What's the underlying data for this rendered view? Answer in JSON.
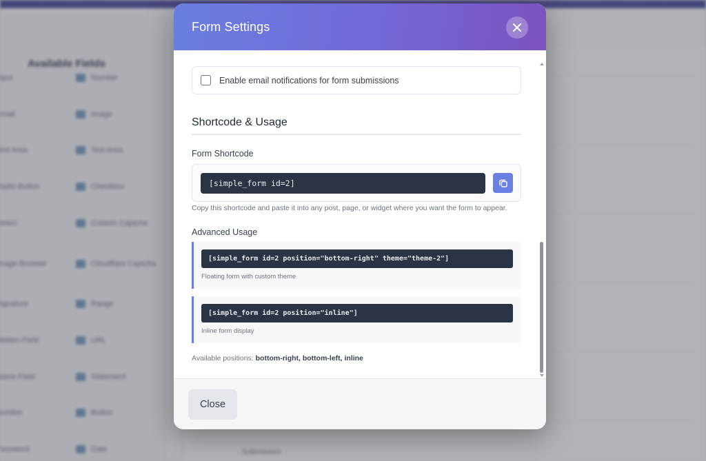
{
  "background": {
    "panel_title": "Available Fields",
    "fields_left": [
      "Input",
      "Email",
      "Text Area",
      "Radio Button",
      "Select",
      "Image Browser",
      "Signature",
      "Hidden Field",
      "Name Field",
      "Number",
      "Password"
    ],
    "fields_right": [
      "Number",
      "Image",
      "Text Area",
      "Checkbox",
      "Custom Captcha",
      "Cloudflare Captcha",
      "Range",
      "URL",
      "Statement",
      "Button",
      "Date"
    ],
    "main_text": "Submission"
  },
  "modal": {
    "title": "Form Settings",
    "notification": {
      "label": "Enable email notifications for form submissions",
      "checked": false
    },
    "section_title": "Shortcode & Usage",
    "shortcode": {
      "label": "Form Shortcode",
      "value": "[simple_form id=2]",
      "help": "Copy this shortcode and paste it into any post, page, or widget where you want the form to appear."
    },
    "advanced": {
      "label": "Advanced Usage",
      "items": [
        {
          "code": "[simple_form id=2 position=\"bottom-right\" theme=\"theme-2\"]",
          "desc": "Floating form with custom theme"
        },
        {
          "code": "[simple_form id=2 position=\"inline\"]",
          "desc": "Inline form display"
        }
      ]
    },
    "positions": {
      "prefix": "Available positions:",
      "values": "bottom-right, bottom-left, inline"
    },
    "footer": {
      "close_label": "Close"
    }
  },
  "colors": {
    "header_gradient_start": "#6a7fe0",
    "header_gradient_end": "#7b52bf",
    "accent": "#6b7fe2",
    "code_bg": "#2a3444"
  }
}
